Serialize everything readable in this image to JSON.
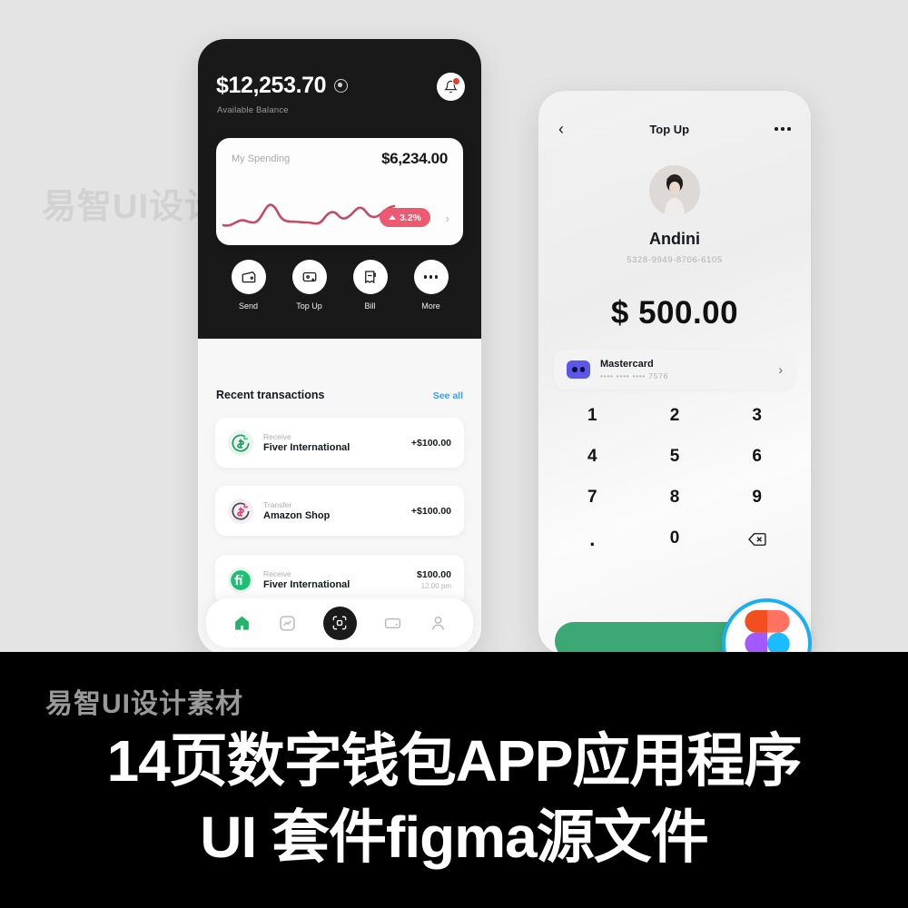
{
  "watermark": {
    "top": "易智UI设计素材",
    "banner": "易智UI设计素材"
  },
  "banner": {
    "line1": "14页数字钱包APP应用程序",
    "line2": "UI 套件figma源文件"
  },
  "figma": {
    "icon": "figma-logo"
  },
  "wallet_screen": {
    "balance": "$12,253.70",
    "balance_label": "Available Balance",
    "eye_icon": "eye-icon",
    "bell_icon": "bell-icon",
    "spending": {
      "label": "My Spending",
      "amount": "$6,234.00",
      "change": "3.2%",
      "chevron": "chevron-right-icon"
    },
    "actions": [
      {
        "label": "Send",
        "icon": "wallet-send-icon"
      },
      {
        "label": "Top Up",
        "icon": "card-plus-icon"
      },
      {
        "label": "Bill",
        "icon": "bill-icon"
      },
      {
        "label": "More",
        "icon": "more-dots-icon"
      }
    ],
    "transactions_title": "Recent transactions",
    "see_all": "See all",
    "transactions": [
      {
        "type": "Receive",
        "name": "Fiver International",
        "amount": "+$100.00",
        "time": "",
        "icon": "receive-green-icon"
      },
      {
        "type": "Transfer",
        "name": "Amazon Shop",
        "amount": "+$100.00",
        "time": "",
        "icon": "transfer-pink-icon"
      },
      {
        "type": "Receive",
        "name": "Fiver International",
        "amount": "$100.00",
        "time": "12.00 pm",
        "icon": "fiverr-icon"
      }
    ],
    "nav": [
      {
        "name": "home",
        "icon": "home-icon",
        "active": true
      },
      {
        "name": "analytics",
        "icon": "chart-icon",
        "active": false
      },
      {
        "name": "scan",
        "icon": "qr-scan-icon",
        "active": false
      },
      {
        "name": "cards",
        "icon": "card-icon",
        "active": false
      },
      {
        "name": "profile",
        "icon": "user-icon",
        "active": false
      }
    ]
  },
  "topup_screen": {
    "back_icon": "chevron-left-icon",
    "title": "Top Up",
    "menu_icon": "more-dots-icon",
    "avatar": "user-avatar",
    "user_name": "Andini",
    "card_number": "5328-9949-8706-6105",
    "amount": "$ 500.00",
    "payment_method": {
      "name": "Mastercard",
      "masked": "•••• •••• •••• 7576",
      "logo": "mastercard-icon",
      "chevron": "chevron-right-icon"
    },
    "keypad": [
      "1",
      "2",
      "3",
      "4",
      "5",
      "6",
      "7",
      "8",
      "9",
      ".",
      "0",
      "⌫"
    ],
    "cta_color": "#3ba875"
  },
  "colors": {
    "dark": "#191919",
    "accent_pink": "#eb5a70",
    "accent_blue": "#3d9bf2",
    "accent_green": "#3ba875",
    "figma_ring": "#18b0f3"
  }
}
